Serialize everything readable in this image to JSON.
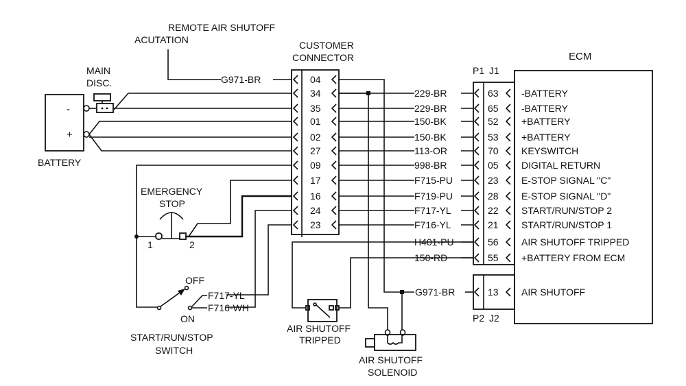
{
  "labels": {
    "remote_air_shutoff": "REMOTE AIR SHUTOFF",
    "acutation": "ACUTATION",
    "customer": "CUSTOMER",
    "connector": "CONNECTOR",
    "ecm": "ECM",
    "main": "MAIN",
    "disc": "DISC.",
    "battery": "BATTERY",
    "battery_minus": "-",
    "battery_plus": "+",
    "emergency": "EMERGENCY",
    "stop": "STOP",
    "estop_pin1": "1",
    "estop_pin2": "2",
    "off": "OFF",
    "on": "ON",
    "switch_line1": "START/RUN/STOP",
    "switch_line2": "SWITCH",
    "switch_wire_top": "F717-YL",
    "switch_wire_bottom": "F716-WH",
    "tripped_line1": "AIR SHUTOFF",
    "tripped_line2": "TRIPPED",
    "solenoid_line1": "AIR SHUTOFF",
    "solenoid_line2": "SOLENOID",
    "remote_wire": "G971-BR",
    "solenoid_wire": "G971-BR",
    "p1": "P1",
    "j1": "J1",
    "p2": "P2",
    "j2": "J2"
  },
  "customer_pins": [
    "04",
    "34",
    "35",
    "01",
    "02",
    "27",
    "09",
    "17",
    "16",
    "24",
    "23"
  ],
  "j1_rows": [
    {
      "wire": "229-BR",
      "pin": "63",
      "signal": "-BATTERY"
    },
    {
      "wire": "229-BR",
      "pin": "65",
      "signal": "-BATTERY"
    },
    {
      "wire": "150-BK",
      "pin": "52",
      "signal": "+BATTERY"
    },
    {
      "wire": "150-BK",
      "pin": "53",
      "signal": "+BATTERY"
    },
    {
      "wire": "113-OR",
      "pin": "70",
      "signal": "KEYSWITCH"
    },
    {
      "wire": "998-BR",
      "pin": "05",
      "signal": "DIGITAL RETURN"
    },
    {
      "wire": "F715-PU",
      "pin": "23",
      "signal": "E-STOP SIGNAL \"C\""
    },
    {
      "wire": "F719-PU",
      "pin": "28",
      "signal": "E-STOP SIGNAL \"D\""
    },
    {
      "wire": "F717-YL",
      "pin": "22",
      "signal": "START/RUN/STOP 2"
    },
    {
      "wire": "F716-YL",
      "pin": "21",
      "signal": "START/RUN/STOP 1"
    },
    {
      "wire": "H401-PU",
      "pin": "56",
      "signal": "AIR SHUTOFF TRIPPED"
    },
    {
      "wire": "150-RD",
      "pin": "55",
      "signal": "+BATTERY FROM ECM"
    }
  ],
  "j2_rows": [
    {
      "pin": "13",
      "signal": "AIR SHUTOFF"
    }
  ]
}
